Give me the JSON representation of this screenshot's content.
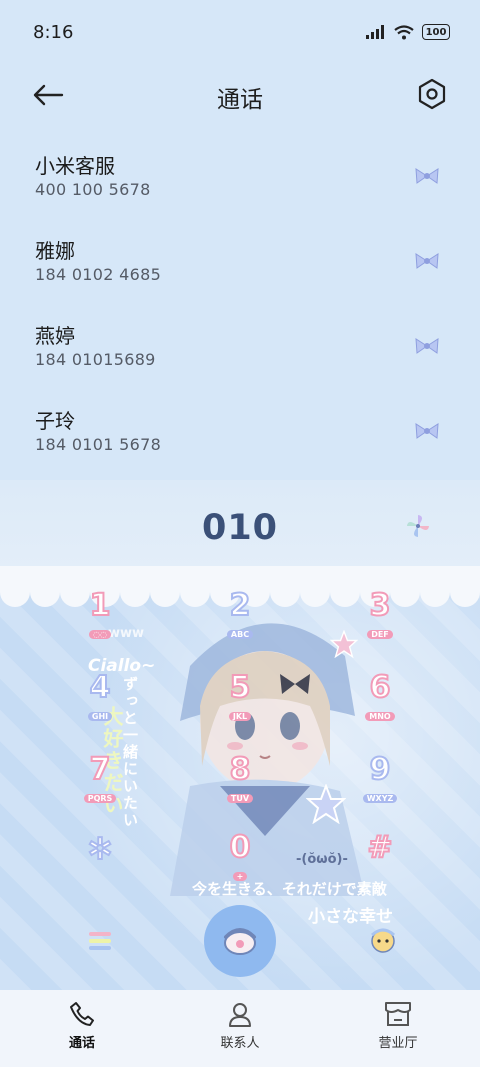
{
  "status": {
    "time": "8:16",
    "battery": "100"
  },
  "header": {
    "title": "通话"
  },
  "recents": [
    {
      "name": "小米客服",
      "number": "400 100 5678"
    },
    {
      "name": "雅娜",
      "number": "184 0102 4685"
    },
    {
      "name": "燕婷",
      "number": "184 01015689"
    },
    {
      "name": "子玲",
      "number": "184 0101 5678"
    }
  ],
  "dialer": {
    "typed_number": "010"
  },
  "keys": [
    {
      "digit": "1",
      "letters": "◌◌",
      "color": "#f29bb8"
    },
    {
      "digit": "2",
      "letters": "ABC",
      "color": "#a9b9ef"
    },
    {
      "digit": "3",
      "letters": "DEF",
      "color": "#f29bb8"
    },
    {
      "digit": "4",
      "letters": "GHI",
      "color": "#a9b9ef"
    },
    {
      "digit": "5",
      "letters": "JKL",
      "color": "#f29bb8"
    },
    {
      "digit": "6",
      "letters": "MNO",
      "color": "#f29bb8"
    },
    {
      "digit": "7",
      "letters": "PQRS",
      "color": "#f29bb8"
    },
    {
      "digit": "8",
      "letters": "TUV",
      "color": "#f29bb8"
    },
    {
      "digit": "9",
      "letters": "WXYZ",
      "color": "#a9b9ef"
    },
    {
      "digit": "0",
      "letters": "+",
      "color": "#f29bb8"
    },
    {
      "digit": "#",
      "letters": "",
      "color": "#f29bb8"
    }
  ],
  "decor": {
    "ciallo": "Ciallo~",
    "www": "www",
    "face": "-(ŏωŏ)-",
    "jp_line1": "今を生きる、それだけで素敵",
    "jp_line2": "小さな幸せ",
    "v_left": "大好きだい",
    "v_mid": "ずっと一緒にいたい"
  },
  "nav": [
    {
      "label": "通话",
      "icon": "phone-icon"
    },
    {
      "label": "联系人",
      "icon": "contacts-icon"
    },
    {
      "label": "营业厅",
      "icon": "store-icon"
    }
  ]
}
